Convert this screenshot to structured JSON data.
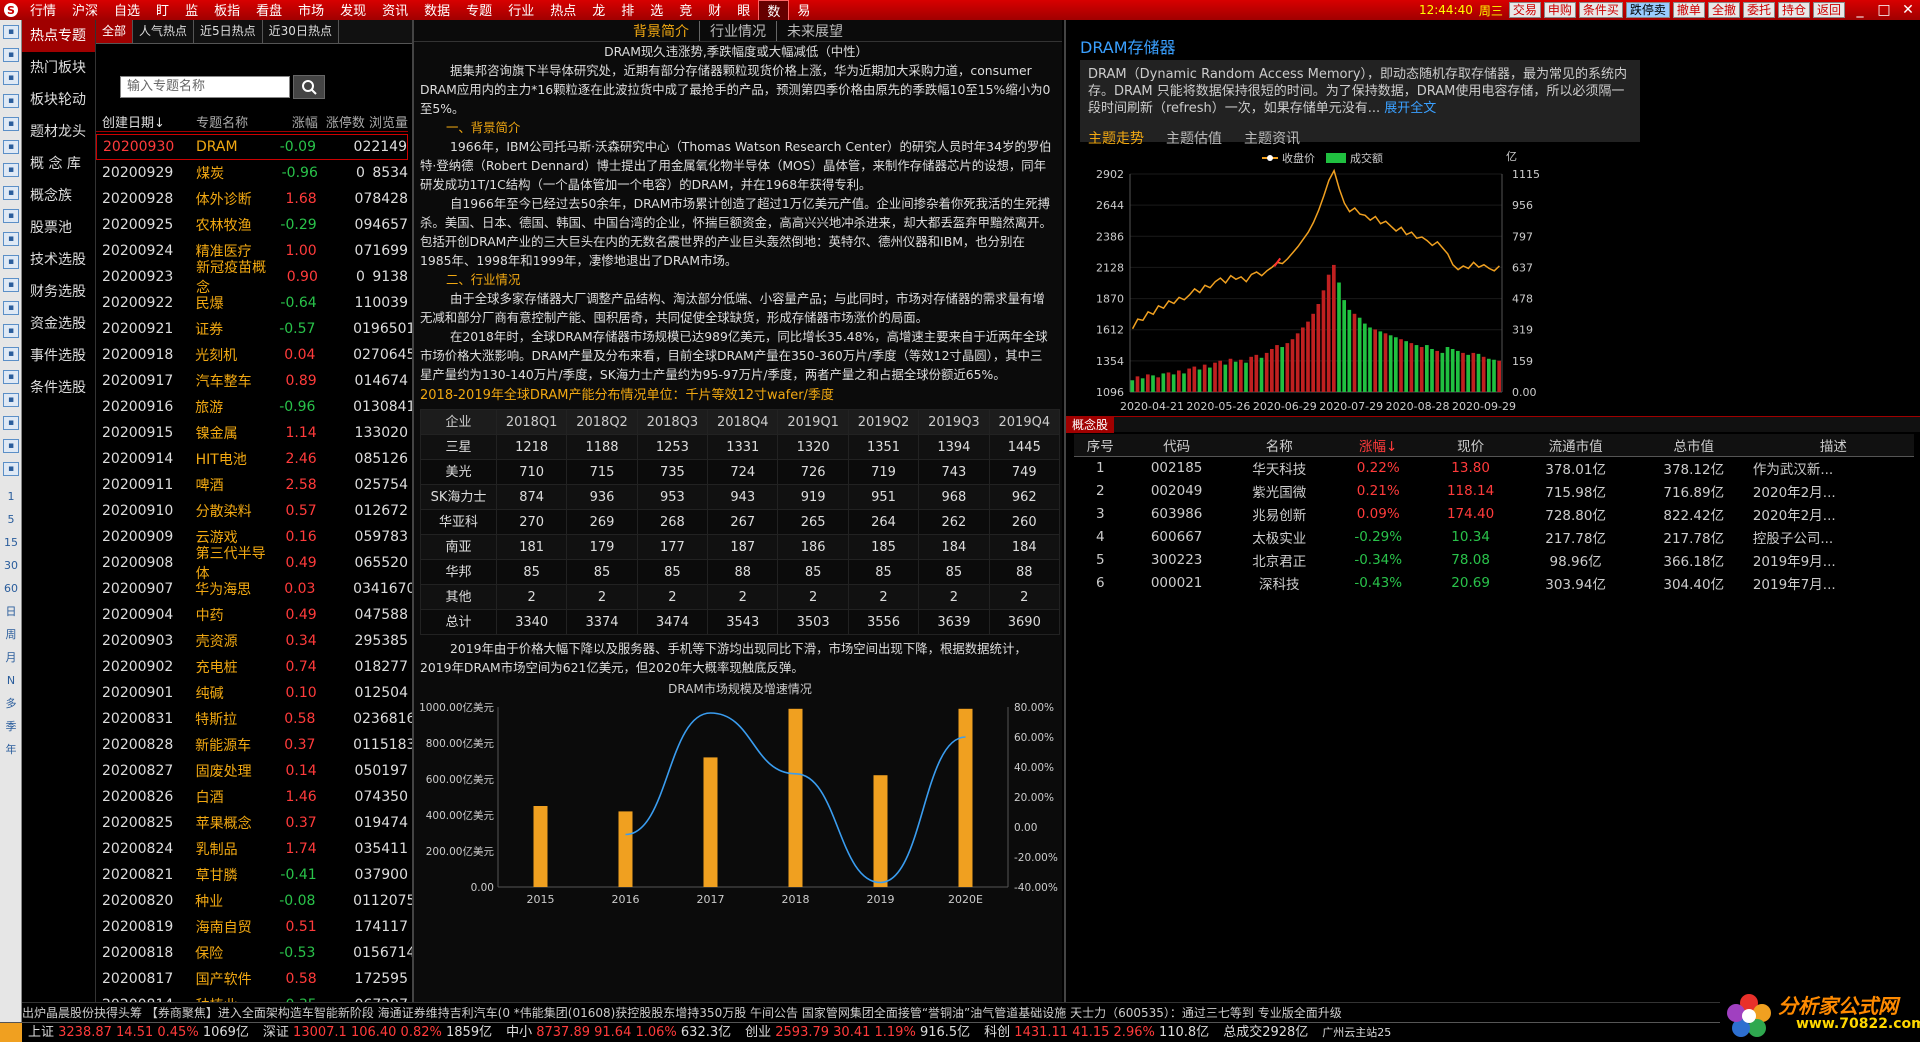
{
  "menubar": {
    "logo": "S",
    "items": [
      "行情",
      "沪深",
      "自选",
      "盯",
      "监",
      "板指",
      "看盘",
      "市场",
      "发现",
      "资讯",
      "数据",
      "专题",
      "行业",
      "热点",
      "龙",
      "排",
      "选",
      "竞",
      "财",
      "眼",
      "数",
      "易"
    ],
    "active_index": 20,
    "time": "12:44:40",
    "weekday": "周三",
    "tools": [
      "交易",
      "申购",
      "条件买",
      "跌停卖",
      "撤单",
      "全撤",
      "委托",
      "持仓",
      "返回"
    ],
    "tools_highlight": [
      3
    ],
    "win_controls": [
      "_",
      "□",
      "✕"
    ]
  },
  "lefticons": {
    "icons": [
      "back-icon",
      "up-icon",
      "down-icon",
      "grid-icon",
      "table-icon",
      "chart-icon",
      "bar-icon",
      "list-icon",
      "doc-icon",
      "f10-icon",
      "money-icon",
      "news-icon",
      "fx-icon",
      "info-icon",
      "clock-icon",
      "panel-icon",
      "arrow-icon",
      "edit-icon",
      "pencil-icon",
      "flag-icon"
    ],
    "periods": [
      "1",
      "5",
      "15",
      "30",
      "60",
      "日",
      "周",
      "月",
      "N",
      "多",
      "季",
      "年"
    ]
  },
  "nav": {
    "items": [
      "热点专题",
      "热门板块",
      "板块轮动",
      "题材龙头",
      "概 念 库",
      "概念族",
      "股票池",
      "技术选股",
      "财务选股",
      "资金选股",
      "事件选股",
      "条件选股"
    ],
    "active_index": 0
  },
  "topics": {
    "tabs": [
      "全部",
      "人气热点",
      "近5日热点",
      "近30日热点"
    ],
    "active_tab": 0,
    "search_placeholder": "输入专题名称",
    "columns": [
      "创建日期↓",
      "专题名称",
      "涨幅",
      "涨停数",
      "浏览量"
    ],
    "rows": [
      {
        "date": "20200930",
        "name": "DRAM",
        "chg": "-0.09",
        "lim": "0",
        "views": "22149"
      },
      {
        "date": "20200929",
        "name": "煤炭",
        "chg": "-0.96",
        "lim": "0",
        "views": "8534"
      },
      {
        "date": "20200928",
        "name": "体外诊断",
        "chg": "1.68",
        "lim": "0",
        "views": "78428"
      },
      {
        "date": "20200925",
        "name": "农林牧渔",
        "chg": "-0.29",
        "lim": "0",
        "views": "94657"
      },
      {
        "date": "20200924",
        "name": "精准医疗",
        "chg": "1.00",
        "lim": "0",
        "views": "71699"
      },
      {
        "date": "20200923",
        "name": "新冠疫苗概念",
        "chg": "0.90",
        "lim": "0",
        "views": "9138"
      },
      {
        "date": "20200922",
        "name": "民爆",
        "chg": "-0.64",
        "lim": "1",
        "views": "10039"
      },
      {
        "date": "20200921",
        "name": "证券",
        "chg": "-0.57",
        "lim": "0",
        "views": "196501"
      },
      {
        "date": "20200918",
        "name": "光刻机",
        "chg": "0.04",
        "lim": "0",
        "views": "270645"
      },
      {
        "date": "20200917",
        "name": "汽车整车",
        "chg": "0.89",
        "lim": "0",
        "views": "14674"
      },
      {
        "date": "20200916",
        "name": "旅游",
        "chg": "-0.96",
        "lim": "0",
        "views": "130841"
      },
      {
        "date": "20200915",
        "name": "镍金属",
        "chg": "1.14",
        "lim": "1",
        "views": "33020"
      },
      {
        "date": "20200914",
        "name": "HIT电池",
        "chg": "2.46",
        "lim": "0",
        "views": "85126"
      },
      {
        "date": "20200911",
        "name": "啤酒",
        "chg": "2.58",
        "lim": "0",
        "views": "25754"
      },
      {
        "date": "20200910",
        "name": "分散染料",
        "chg": "0.57",
        "lim": "0",
        "views": "12672"
      },
      {
        "date": "20200909",
        "name": "云游戏",
        "chg": "0.16",
        "lim": "0",
        "views": "59783"
      },
      {
        "date": "20200908",
        "name": "第三代半导体",
        "chg": "0.49",
        "lim": "0",
        "views": "65520"
      },
      {
        "date": "20200907",
        "name": "华为海思",
        "chg": "0.03",
        "lim": "0",
        "views": "341670"
      },
      {
        "date": "20200904",
        "name": "中药",
        "chg": "0.49",
        "lim": "0",
        "views": "47588"
      },
      {
        "date": "20200903",
        "name": "壳资源",
        "chg": "0.34",
        "lim": "2",
        "views": "95385"
      },
      {
        "date": "20200902",
        "name": "充电桩",
        "chg": "0.74",
        "lim": "0",
        "views": "18277"
      },
      {
        "date": "20200901",
        "name": "纯碱",
        "chg": "0.10",
        "lim": "0",
        "views": "12504"
      },
      {
        "date": "20200831",
        "name": "特斯拉",
        "chg": "0.58",
        "lim": "0",
        "views": "236816"
      },
      {
        "date": "20200828",
        "name": "新能源车",
        "chg": "0.37",
        "lim": "0",
        "views": "115183"
      },
      {
        "date": "20200827",
        "name": "固废处理",
        "chg": "0.14",
        "lim": "0",
        "views": "50197"
      },
      {
        "date": "20200826",
        "name": "白酒",
        "chg": "1.46",
        "lim": "0",
        "views": "74350"
      },
      {
        "date": "20200825",
        "name": "苹果概念",
        "chg": "0.37",
        "lim": "0",
        "views": "19474"
      },
      {
        "date": "20200824",
        "name": "乳制品",
        "chg": "1.74",
        "lim": "0",
        "views": "35411"
      },
      {
        "date": "20200821",
        "name": "草甘膦",
        "chg": "-0.41",
        "lim": "0",
        "views": "37900"
      },
      {
        "date": "20200820",
        "name": "种业",
        "chg": "-0.08",
        "lim": "0",
        "views": "112075"
      },
      {
        "date": "20200819",
        "name": "海南自贸",
        "chg": "0.51",
        "lim": "1",
        "views": "74117"
      },
      {
        "date": "20200818",
        "name": "保险",
        "chg": "-0.53",
        "lim": "0",
        "views": "156714"
      },
      {
        "date": "20200817",
        "name": "国产软件",
        "chg": "0.58",
        "lim": "1",
        "views": "72595"
      },
      {
        "date": "20200814",
        "name": "种植业",
        "chg": "-0.35",
        "lim": "0",
        "views": "67297"
      }
    ]
  },
  "center": {
    "tabs": [
      "背景简介",
      "行业情况",
      "未来展望"
    ],
    "active_tab": 0,
    "headline": "DRAM现久违涨势,季跌幅度或大幅减低（中性）",
    "intro": "据集邦咨询旗下半导体研究处，近期有部分存储器颗粒现货价格上涨，华为近期加大采购力道，consumer DRAM应用内的主力*16颗粒逐在此波拉货中成了最抢手的产品，预测第四季价格由原先的季跌幅10至15%缩小为0至5%。",
    "section1": "一、背景简介",
    "p1": "1966年，IBM公司托马斯·沃森研究中心（Thomas Watson Research Center）的研究人员时年34岁的罗伯特·登纳德（Robert Dennard）博士提出了用金属氧化物半导体（MOS）晶体管，来制作存储器芯片的设想，同年研发成功1T/1C结构（一个晶体管加一个电容）的DRAM，并在1968年获得专利。",
    "p2": "自1966年至今已经过去50余年，DRAM市场累计创造了超过1万亿美元产值。企业间掺杂着你死我活的生死搏杀。美国、日本、德国、韩国、中国台湾的企业，怀揣巨额资金，高高兴兴地冲杀进来，却大都丢盔弃甲黯然离开。包括开创DRAM产业的三大巨头在内的无数名震世界的产业巨头轰然倒地：英特尔、德州仪器和IBM，也分别在1985年、1998年和1999年，凄惨地退出了DRAM市场。",
    "section2": "二、行业情况",
    "p3": "由于全球多家存储器大厂调整产品结构、淘汰部分低端、小容量产品；与此同时，市场对存储器的需求量有增无减和部分厂商有意控制产能、囤积居奇，共同促使全球缺货，形成存储器市场涨价的局面。",
    "p4": "在2018年时，全球DRAM存储器市场规模已达989亿美元，同比增长35.48%，高增速主要来自于近两年全球市场价格大涨影响。DRAM产量及分布来看，目前全球DRAM产量在350-360万片/季度（等效12寸晶圆），其中三星产量约为130-140万片/季度，SK海力士产量约为95-97万片/季度，两者产量之和占据全球份额近65%。",
    "table_title": "2018-2019年全球DRAM产能分布情况单位：千片等效12寸wafer/季度",
    "table": {
      "header": [
        "企业",
        "2018Q1",
        "2018Q2",
        "2018Q3",
        "2018Q4",
        "2019Q1",
        "2019Q2",
        "2019Q3",
        "2019Q4"
      ],
      "rows": [
        [
          "三星",
          "1218",
          "1188",
          "1253",
          "1331",
          "1320",
          "1351",
          "1394",
          "1445"
        ],
        [
          "美光",
          "710",
          "715",
          "735",
          "724",
          "726",
          "719",
          "743",
          "749"
        ],
        [
          "SK海力士",
          "874",
          "936",
          "953",
          "943",
          "919",
          "951",
          "968",
          "962"
        ],
        [
          "华亚科",
          "270",
          "269",
          "268",
          "267",
          "265",
          "264",
          "262",
          "260"
        ],
        [
          "南亚",
          "181",
          "179",
          "177",
          "187",
          "186",
          "185",
          "184",
          "184"
        ],
        [
          "华邦",
          "85",
          "85",
          "85",
          "88",
          "85",
          "85",
          "85",
          "88"
        ],
        [
          "其他",
          "2",
          "2",
          "2",
          "2",
          "2",
          "2",
          "2",
          "2"
        ],
        [
          "总计",
          "3340",
          "3374",
          "3474",
          "3543",
          "3503",
          "3556",
          "3639",
          "3690"
        ]
      ]
    },
    "p5": "2019年由于价格大幅下降以及服务器、手机等下游均出现同比下滑，市场空间出现下降，根据数据统计，2019年DRAM市场空间为621亿美元，但2020年大概率现触底反弹。"
  },
  "chart_data": [
    {
      "type": "bar",
      "title": "DRAM市场规模及增速情况",
      "categories": [
        "2015",
        "2016",
        "2017",
        "2018",
        "2019",
        "2020E"
      ],
      "series": [
        {
          "values": [
            450,
            420,
            720,
            990,
            621,
            990
          ]
        },
        {
          "values": [
            null,
            -5,
            76,
            35.48,
            -37,
            60
          ]
        }
      ],
      "y_left": {
        "ticks": [
          "0.00",
          "200.00亿美元",
          "400.00亿美元",
          "600.00亿美元",
          "800.00亿美元",
          "1000.00亿美元"
        ],
        "range": [
          0,
          1000
        ]
      },
      "y_right": {
        "ticks": [
          "-40.00%",
          "-20.00%",
          "0.00",
          "20.00%",
          "40.00%",
          "60.00%",
          "80.00%"
        ],
        "range": [
          -40,
          80
        ]
      },
      "colors": {
        "bar": "#f0a020",
        "line": "#3a9df0"
      }
    },
    {
      "type": "line",
      "legend": [
        "收盘价",
        "成交额"
      ],
      "legend_position": "top",
      "unit_right": "亿",
      "x_ticks": [
        "2020-04-21",
        "2020-05-26",
        "2020-06-29",
        "2020-07-29",
        "2020-08-28",
        "2020-09-29"
      ],
      "y_left": {
        "ticks": [
          "1096",
          "1354",
          "1612",
          "1870",
          "2128",
          "2386",
          "2644",
          "2902"
        ],
        "range": [
          1096,
          2902
        ]
      },
      "y_right": {
        "ticks": [
          "0.00",
          "159",
          "319",
          "478",
          "637",
          "797",
          "956",
          "1115"
        ],
        "range": [
          0,
          1115
        ]
      },
      "close": [
        1620,
        1700,
        1690,
        1760,
        1740,
        1810,
        1790,
        1850,
        1830,
        1880,
        1860,
        1900,
        1950,
        1920,
        1980,
        1960,
        2010,
        2040,
        2000,
        2060,
        2030,
        2050,
        2010,
        2070,
        2090,
        2060,
        2100,
        2130,
        2170,
        2160,
        2200,
        2250,
        2300,
        2360,
        2420,
        2500,
        2600,
        2720,
        2850,
        2930,
        2780,
        2660,
        2590,
        2620,
        2570,
        2560,
        2520,
        2550,
        2490,
        2510,
        2470,
        2430,
        2460,
        2400,
        2420,
        2370,
        2380,
        2350,
        2310,
        2340,
        2290,
        2240,
        2150,
        2110,
        2140,
        2120,
        2170,
        2130,
        2150,
        2120,
        2100,
        2140
      ],
      "volume": [
        60,
        80,
        70,
        90,
        85,
        75,
        95,
        100,
        90,
        110,
        95,
        120,
        130,
        115,
        140,
        125,
        150,
        160,
        140,
        170,
        155,
        165,
        150,
        180,
        190,
        175,
        200,
        220,
        240,
        230,
        250,
        270,
        300,
        330,
        360,
        400,
        450,
        520,
        600,
        650,
        560,
        470,
        420,
        400,
        380,
        350,
        330,
        320,
        310,
        300,
        290,
        280,
        270,
        260,
        250,
        240,
        230,
        240,
        220,
        210,
        200,
        230,
        220,
        210,
        200,
        190,
        200,
        195,
        180,
        170,
        165,
        160
      ],
      "colors": {
        "close": "#f0a020",
        "volume": "#c02020",
        "volume_up": "#20c040",
        "mark": "#ff3030"
      }
    }
  ],
  "right": {
    "title": "DRAM存储器",
    "desc": "DRAM（Dynamic Random Access Memory），即动态随机存取存储器，最为常见的系统内存。DRAM 只能将数据保持很短的时间。为了保持数据，DRAM使用电容存储，所以必须隔一段时间刷新（refresh）一次，如果存储单元没有...",
    "more": "展开全文",
    "tabs": [
      "主题走势",
      "主题估值",
      "主题资讯"
    ],
    "active_tab": 0,
    "concept_label": "概念股",
    "columns": [
      "序号",
      "代码",
      "名称",
      "涨幅↓",
      "现价",
      "流通市值",
      "总市值",
      "描述"
    ],
    "rows": [
      {
        "no": "1",
        "code": "002185",
        "name": "华天科技",
        "chg": "0.22%",
        "price": "13.80",
        "float": "378.01亿",
        "total": "378.12亿",
        "desc": "作为武汉新..."
      },
      {
        "no": "2",
        "code": "002049",
        "name": "紫光国微",
        "chg": "0.21%",
        "price": "118.14",
        "float": "715.98亿",
        "total": "716.89亿",
        "desc": "2020年2月..."
      },
      {
        "no": "3",
        "code": "603986",
        "name": "兆易创新",
        "chg": "0.09%",
        "price": "174.40",
        "float": "728.80亿",
        "total": "822.42亿",
        "desc": "2020年2月..."
      },
      {
        "no": "4",
        "code": "600667",
        "name": "太极实业",
        "chg": "-0.29%",
        "price": "10.34",
        "float": "217.78亿",
        "total": "217.78亿",
        "desc": "控股子公司..."
      },
      {
        "no": "5",
        "code": "300223",
        "name": "北京君正",
        "chg": "-0.34%",
        "price": "78.08",
        "float": "98.96亿",
        "total": "366.18亿",
        "desc": "2019年9月..."
      },
      {
        "no": "6",
        "code": "000021",
        "name": "深科技",
        "chg": "-0.43%",
        "price": "20.69",
        "float": "303.94亿",
        "total": "304.40亿",
        "desc": "2019年7月..."
      }
    ]
  },
  "ticker": "出炉晶晨股份抉得头筹    【券商聚焦】进入全面架构造车智能新阶段    海通证券维持吉利汽车(0    *伟能集团(01608)获控股股东增持350万股    午间公告    国家管网集团全面接管“誉铜油”油气管道基础设施    天士力（600535）：通过三七等到    专业版全面升级",
  "status": [
    {
      "label": "上证",
      "val": "3238.87",
      "chg": "14.51",
      "pct": "0.45%",
      "amt": "1069亿",
      "dir": "up"
    },
    {
      "label": "深证",
      "val": "13007.1",
      "chg": "106.40",
      "pct": "0.82%",
      "amt": "1859亿",
      "dir": "up"
    },
    {
      "label": "中小",
      "val": "8737.89",
      "chg": "91.64",
      "pct": "1.06%",
      "amt": "632.3亿",
      "dir": "up"
    },
    {
      "label": "创业",
      "val": "2593.79",
      "chg": "30.41",
      "pct": "1.19%",
      "amt": "916.5亿",
      "dir": "up"
    },
    {
      "label": "科创",
      "val": "1431.11",
      "chg": "41.15",
      "pct": "2.96%",
      "amt": "110.8亿",
      "dir": "up"
    }
  ],
  "status_total": "总成交2928亿",
  "status_server": "广州云主站25",
  "brand": {
    "name": "分析家公式网",
    "url": "www.70822.com"
  }
}
